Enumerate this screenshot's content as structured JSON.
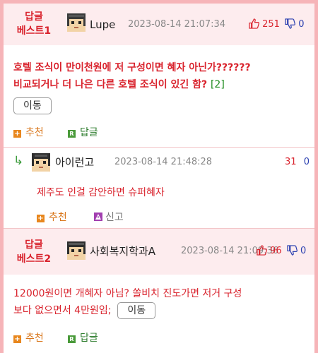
{
  "comments": [
    {
      "best_label": [
        "답글",
        "베스트1"
      ],
      "nickname": "Lupe",
      "date": "2023-08-14 21:07:34",
      "likes": "251",
      "dislikes": "0",
      "text_line1": "호텔 조식이 만이천원에 저 구성이면 혜자 아닌가??????",
      "text_line2": "비교되거나 더 나은 다른 호텔 조식이 있긴 함?",
      "reply_count": "[2]",
      "move_label": "이동",
      "recommend_label": "추천",
      "reply_label": "답글"
    },
    {
      "reply_arrow": "↳",
      "nickname": "아이런고",
      "date": "2023-08-14 21:48:28",
      "likes": "31",
      "dislikes": "0",
      "text": "제주도 인걸 감안하면 슈퍼혜자",
      "recommend_label": "추천",
      "report_label": "신고"
    },
    {
      "best_label": [
        "답글",
        "베스트2"
      ],
      "nickname": "사회복지학과A",
      "date": "2023-08-14 21:09:36",
      "likes": "96",
      "dislikes": "0",
      "text_line1": "12000원이면 개혜자 아님? 쏠비치 진도가면 저거 구성",
      "text_line2": "보다 없으면서 4만원임;",
      "move_label": "이동",
      "recommend_label": "추천",
      "reply_label": "답글"
    }
  ],
  "colors": {
    "accent_red": "#d9232d",
    "border_pink": "#f6b4b8",
    "header_pink": "#fdecee",
    "dislike_blue": "#2a3fb0",
    "recommend_orange": "#e8871e",
    "reply_green": "#4a9a3a"
  },
  "icons": [
    "avatar-icon",
    "thumbs-up-icon",
    "thumbs-down-icon",
    "plus-icon",
    "reply-r-icon",
    "reply-arrow-icon",
    "report-icon"
  ]
}
